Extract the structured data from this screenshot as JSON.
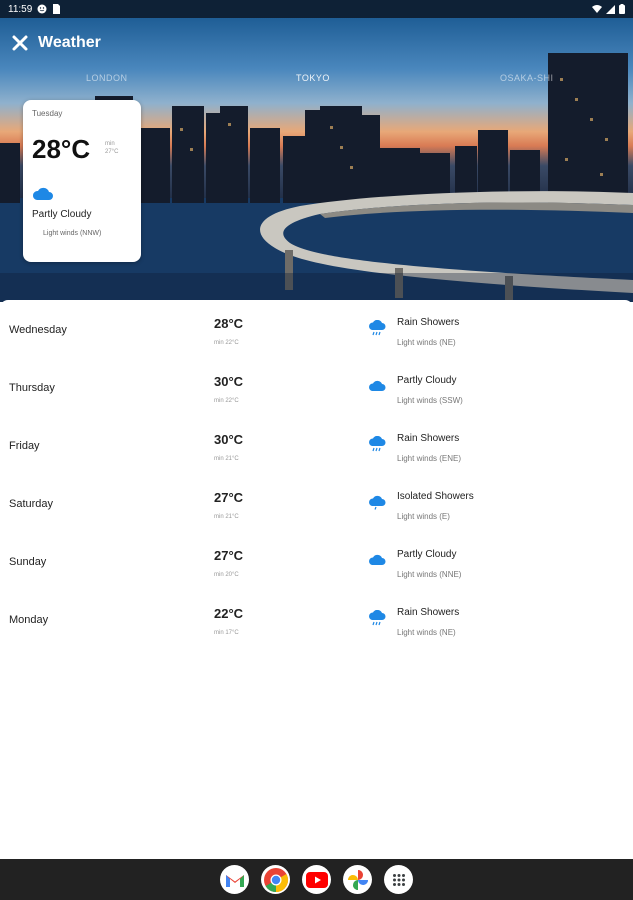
{
  "status_bar": {
    "time": "11:59"
  },
  "header": {
    "title": "Weather"
  },
  "cities": [
    {
      "name": "LONDON"
    },
    {
      "name": "TOKYO"
    },
    {
      "name": "OSAKA-SHI"
    }
  ],
  "active_city_index": 1,
  "today": {
    "day": "Tuesday",
    "temp": "28°C",
    "min_label": "min",
    "min": "27°C",
    "condition": "Partly Cloudy",
    "wind": "Light winds (NNW)",
    "icon": "partly-cloudy-icon"
  },
  "forecast": [
    {
      "day": "Wednesday",
      "temp": "28°C",
      "min": "min 22°C",
      "condition": "Rain Showers",
      "wind": "Light winds (NE)",
      "icon": "rain-showers-icon"
    },
    {
      "day": "Thursday",
      "temp": "30°C",
      "min": "min 22°C",
      "condition": "Partly Cloudy",
      "wind": "Light winds (SSW)",
      "icon": "partly-cloudy-icon"
    },
    {
      "day": "Friday",
      "temp": "30°C",
      "min": "min 21°C",
      "condition": "Rain Showers",
      "wind": "Light winds (ENE)",
      "icon": "rain-showers-icon"
    },
    {
      "day": "Saturday",
      "temp": "27°C",
      "min": "min 21°C",
      "condition": "Isolated Showers",
      "wind": "Light winds (E)",
      "icon": "isolated-showers-icon"
    },
    {
      "day": "Sunday",
      "temp": "27°C",
      "min": "min 20°C",
      "condition": "Partly Cloudy",
      "wind": "Light winds (NNE)",
      "icon": "partly-cloudy-icon"
    },
    {
      "day": "Monday",
      "temp": "22°C",
      "min": "min 17°C",
      "condition": "Rain Showers",
      "wind": "Light winds (NE)",
      "icon": "rain-showers-icon"
    }
  ],
  "taskbar": {
    "apps": [
      {
        "icon": "gmail-icon"
      },
      {
        "icon": "chrome-icon"
      },
      {
        "icon": "youtube-icon"
      },
      {
        "icon": "photos-icon"
      },
      {
        "icon": "app-drawer-icon"
      }
    ]
  },
  "colors": {
    "accent": "#1e88e5",
    "status_bar": "#0e2136",
    "taskbar": "#222222"
  }
}
